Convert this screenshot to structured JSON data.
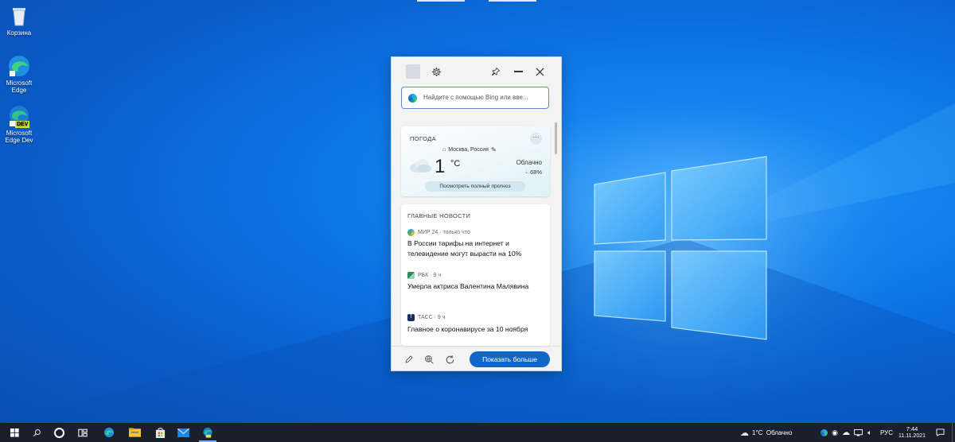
{
  "desktop": {
    "icons": [
      {
        "label": "Корзина"
      },
      {
        "label": "Microsoft Edge"
      },
      {
        "label": "Microsoft Edge Dev",
        "badge": "DEV"
      }
    ]
  },
  "widget": {
    "header": {
      "icons": [
        "avatar",
        "gear-icon",
        "pin-icon",
        "minimize-icon",
        "close-icon"
      ]
    },
    "search": {
      "placeholder": "Найдите с помощью Bing или вве..."
    },
    "weather": {
      "title": "ПОГОДА",
      "location": "Москва, Россия",
      "temperature": "1",
      "unit": "°C",
      "condition": "Облачно",
      "humidity": "68%",
      "forecast_link": "Посмотреть полный прогноз"
    },
    "news": {
      "title": "ГЛАВНЫЕ НОВОСТИ",
      "items": [
        {
          "source": "МИР 24 · только что",
          "headline": "В России тарифы на интернет и телевидение могут вырасти на 10%"
        },
        {
          "source": "РБК · 9 ч",
          "headline": "Умерла актриса Валентина Малявина"
        },
        {
          "source": "ТАСС · 9 ч",
          "headline": "Главное о коронавирусе за 10 ноября"
        }
      ]
    },
    "footer": {
      "show_more": "Показать больше"
    }
  },
  "taskbar": {
    "apps": [
      "start-icon",
      "search-icon",
      "cortana-icon",
      "task-view-icon",
      "edge-icon",
      "file-explorer-icon",
      "store-icon",
      "mail-icon",
      "edge-dev-icon"
    ],
    "weather": "1°C  Облачно",
    "language": "РУС",
    "time": "7:44",
    "date": "11.11.2021"
  }
}
